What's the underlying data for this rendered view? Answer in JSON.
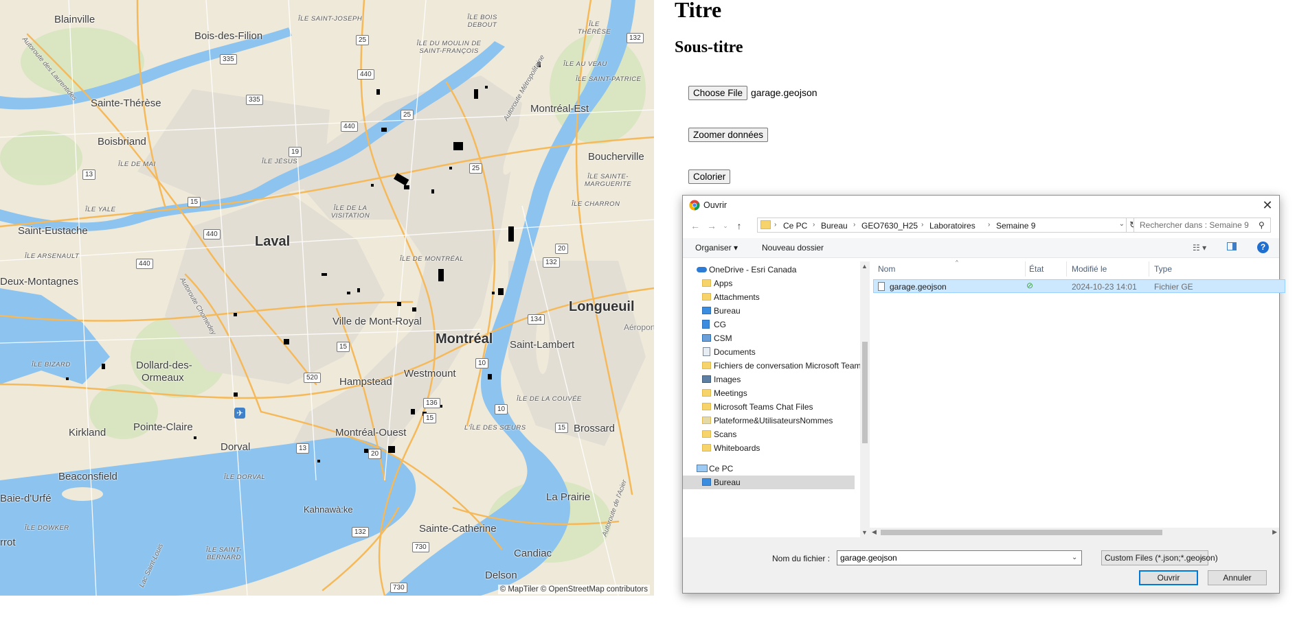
{
  "page": {
    "title": "Titre",
    "subtitle": "Sous-titre"
  },
  "controls": {
    "choose_file_label": "Choose File",
    "selected_file": "garage.geojson",
    "zoom_label": "Zoomer données",
    "color_label": "Colorier"
  },
  "map": {
    "attribution": "© MapTiler © OpenStreetMap contributors",
    "labels": {
      "blainville": "Blainville",
      "bois_des_filion": "Bois-des-Filion",
      "ile_saint_joseph": "ÎLE SAINT-JOSEPH",
      "ile_bois_debout": "ÎLE BOIS DEBOUT",
      "ile_theresse": "ÎLE THÉRÈSE",
      "ile_moulin": "ÎLE DU MOULIN DE SAINT-FRANÇOIS",
      "ile_au_veau": "ÎLE AU VEAU",
      "ile_saint_patrice": "ÎLE SAINT-PATRICE",
      "sainte_therese": "Sainte-Thérèse",
      "montreal_est": "Montréal-Est",
      "boisbriand": "Boisbriand",
      "ile_jesus": "ÎLE JÉSUS",
      "ile_de_mai": "ÎLE DE MAI",
      "boucherville": "Boucherville",
      "ile_sainte_marguerite": "ÎLE SAINTE-MARGUERITE",
      "ile_charron": "ÎLE CHARRON",
      "ile_yale": "ÎLE YALE",
      "ile_visitation": "ÎLE DE LA VISITATION",
      "saint_eustache": "Saint-Eustache",
      "laval": "Laval",
      "ile_arsenault": "ÎLE ARSENAULT",
      "ile_de_montreal": "ÎLE DE MONTRÉAL",
      "deux_montagnes": "Deux-Montagnes",
      "ville_mont_royal": "Ville de Mont-Royal",
      "longueuil": "Longueuil",
      "aeroport": "Aéroport",
      "montreal": "Montréal",
      "saint_lambert": "Saint-Lambert",
      "ile_bizard": "ÎLE BIZARD",
      "dollard": "Dollard-des-",
      "ormeaux": "Ormeaux",
      "hampstead": "Hampstead",
      "westmount": "Westmount",
      "ile_couvee": "ÎLE DE LA COUVÉE",
      "ile_des_soeurs": "L'ÎLE DES SŒURS",
      "kirkland": "Kirkland",
      "pointe_claire": "Pointe-Claire",
      "montreal_ouest": "Montréal-Ouest",
      "brossard": "Brossard",
      "dorval": "Dorval",
      "ile_dorval": "ÎLE DORVAL",
      "beaconsfield": "Beaconsfield",
      "baie_durfe": "Baie-d'Urfé",
      "la_prairie": "La Prairie",
      "ile_dowker": "ÎLE DOWKER",
      "kahnawake": "Kahnawà:ke",
      "sainte_catherine": "Sainte-Catherine",
      "ile_saint_bernard": "ÎLE SAINT-BERNARD",
      "candiac": "Candiac",
      "rrot": "rrot",
      "delson": "Delson",
      "lac_saint_louis": "Lac Saint-Louis",
      "autoroute_laurentides": "Autoroute des Laurentides",
      "autoroute_metropolitaine": "Autoroute Métropolitaine",
      "autoroute_chomedey": "Autoroute Chomedey",
      "autoroute_acier": "Autoroute de l'Acier"
    },
    "shields": {
      "r25a": "25",
      "r132a": "132",
      "r335a": "335",
      "r440a": "440",
      "r335b": "335",
      "r25b": "25",
      "r440b": "440",
      "r19": "19",
      "r25c": "25",
      "r13": "13",
      "r15a": "15",
      "r440c": "440",
      "r440d": "440",
      "r20a": "20",
      "r132b": "132",
      "r134": "134",
      "r15b": "15",
      "r10a": "10",
      "r520": "520",
      "r136": "136",
      "r15c": "15",
      "r10b": "10",
      "r15d": "15",
      "r13b": "13",
      "r20b": "20",
      "r132c": "132",
      "r730a": "730",
      "r730b": "730"
    }
  },
  "dialog": {
    "title": "Ouvrir",
    "breadcrumbs": [
      "Ce PC",
      "Bureau",
      "GEO7630_H25",
      "Laboratoires",
      "Semaine 9"
    ],
    "search_placeholder": "Rechercher dans : Semaine 9",
    "organise_label": "Organiser ▾",
    "new_folder_label": "Nouveau dossier",
    "tree": [
      {
        "label": "OneDrive - Esri Canada",
        "icon": "onedrive-icon"
      },
      {
        "label": "Apps",
        "icon": "folder-icon"
      },
      {
        "label": "Attachments",
        "icon": "folder-icon"
      },
      {
        "label": "Bureau",
        "icon": "desktop-folder-icon"
      },
      {
        "label": "CG",
        "icon": "book-folder-icon"
      },
      {
        "label": "CSM",
        "icon": "network-folder-icon"
      },
      {
        "label": "Documents",
        "icon": "documents-icon"
      },
      {
        "label": "Fichiers de conversation Microsoft Teams",
        "icon": "folder-icon"
      },
      {
        "label": "Images",
        "icon": "images-icon"
      },
      {
        "label": "Meetings",
        "icon": "folder-icon"
      },
      {
        "label": "Microsoft Teams Chat Files",
        "icon": "folder-icon"
      },
      {
        "label": "Plateforme&UtilisateursNommes",
        "icon": "people-folder-icon"
      },
      {
        "label": "Scans",
        "icon": "folder-icon"
      },
      {
        "label": "Whiteboards",
        "icon": "folder-icon"
      },
      {
        "label": "Ce PC",
        "icon": "pc-icon"
      },
      {
        "label": "Bureau",
        "icon": "desktop-folder-icon"
      }
    ],
    "columns": [
      "Nom",
      "État",
      "Modifié le",
      "Type"
    ],
    "files": [
      {
        "name": "garage.geojson",
        "status": "⊘",
        "modified": "2024-10-23 14:01",
        "type": "Fichier GE"
      }
    ],
    "filename_label": "Nom du fichier :",
    "filename_value": "garage.geojson",
    "filter": "Custom Files (*.json;*.geojson)",
    "open_label": "Ouvrir",
    "cancel_label": "Annuler"
  },
  "colors": {
    "water": "#8cc3ef",
    "land": "#efe9d9",
    "urban": "#dedbd2",
    "park": "#cde3b4",
    "highway": "#f5b95a",
    "accent": "#0078d7"
  }
}
